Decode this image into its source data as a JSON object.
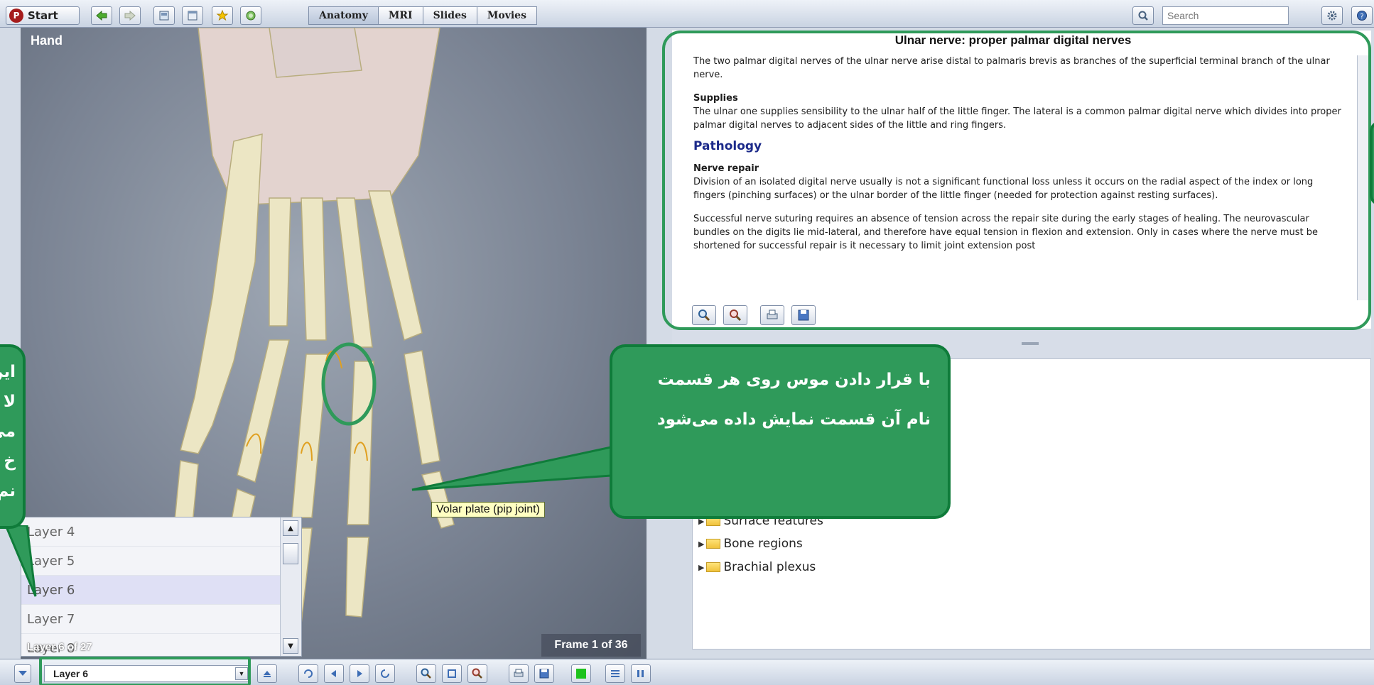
{
  "toolbar": {
    "start_label": "Start",
    "tabs": [
      "Anatomy",
      "MRI",
      "Slides",
      "Movies"
    ],
    "search_placeholder": "Search"
  },
  "viewer": {
    "title": "Hand",
    "frame_label": "Frame 1 of 36",
    "layer_count": "Layer 6 of 27",
    "tooltip": "Volar plate (pip joint)"
  },
  "layers": {
    "items": [
      "Layer 4",
      "Layer 5",
      "Layer 6",
      "Layer 7",
      "Layer 8"
    ],
    "selected": "Layer 6"
  },
  "article": {
    "title": "Ulnar nerve: proper palmar digital nerves",
    "intro": "The two palmar digital nerves of the ulnar nerve arise distal to palmaris brevis as branches of the superficial terminal branch of the ulnar nerve.",
    "supplies_heading": "Supplies",
    "supplies_text": "The ulnar one supplies sensibility to the ulnar half of the little finger. The lateral is a common palmar digital nerve which divides into proper palmar digital nerves to adjacent sides of the little and ring fingers.",
    "pathology_heading": "Pathology",
    "nerve_repair_heading": "Nerve repair",
    "nerve_repair_text": "Division of an isolated digital nerve usually is not a significant functional loss unless it occurs on the radial aspect of the index or long fingers (pinching surfaces) or the ulnar border of the little finger (needed for protection against resting surfaces).",
    "suturing_text": "Successful nerve suturing requires an absence of tension across the repair site during the early stages of healing. The neurovascular bundles on the digits lie mid-lateral, and therefore have equal tension in flexion and extension. Only in cases where the nerve must be shortened for successful repair is it necessary to limit joint extension post"
  },
  "tree": {
    "items": [
      "Surface features",
      "Bone regions",
      "Brachial plexus"
    ]
  },
  "bottom": {
    "layer_select": "Layer 6"
  },
  "callouts": {
    "hover_text": "با قرار دادن موس روی هر قسمت نام آن قسمت نمایش داده می‌شود",
    "layers_text": "این لا می خ نم"
  },
  "colors": {
    "callout_green": "#2f9a5a",
    "callout_border": "#0f7c3a",
    "pathology_blue": "#1c2a8a",
    "tooltip_yellow": "#ffffc2"
  }
}
